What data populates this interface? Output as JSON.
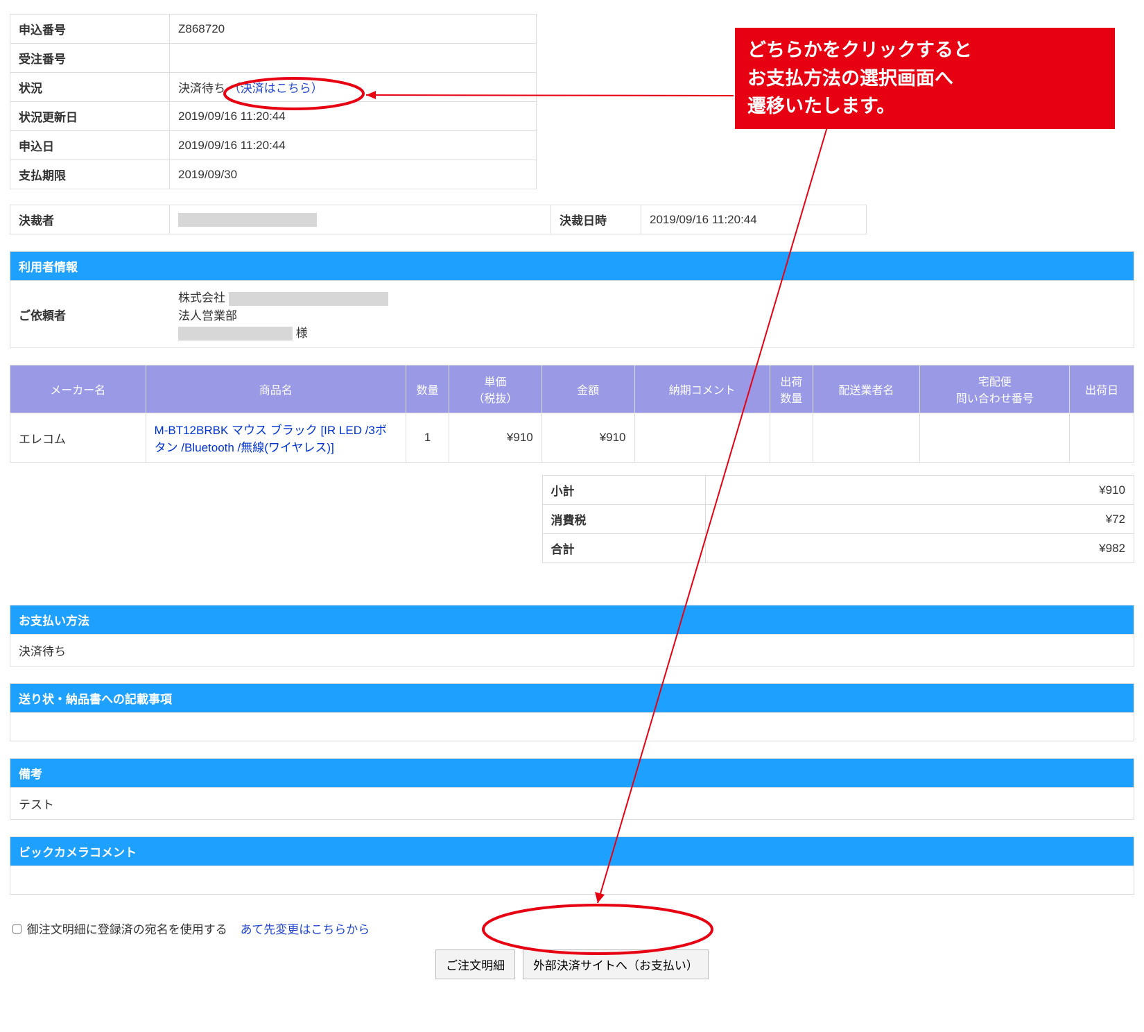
{
  "info": {
    "application_no_label": "申込番号",
    "application_no": "Z868720",
    "order_no_label": "受注番号",
    "order_no": "",
    "status_label": "状況",
    "status_text": "決済待ち",
    "status_link": "（決済はこちら）",
    "status_update_label": "状況更新日",
    "status_update": "2019/09/16 11:20:44",
    "apply_date_label": "申込日",
    "apply_date": "2019/09/16 11:20:44",
    "pay_deadline_label": "支払期限",
    "pay_deadline": "2019/09/30"
  },
  "approver": {
    "person_label": "決裁者",
    "datetime_label": "決裁日時",
    "datetime": "2019/09/16 11:20:44"
  },
  "sections": {
    "user_info": "利用者情報",
    "payment_method": "お支払い方法",
    "delivery_notes": "送り状・納品書への記載事項",
    "remarks": "備考",
    "bic_comment": "ビックカメラコメント"
  },
  "user": {
    "requester_label": "ご依頼者",
    "company_prefix": "株式会社",
    "department": "法人営業部",
    "honorific": "様"
  },
  "products": {
    "headers": {
      "maker": "メーカー名",
      "name": "商品名",
      "qty": "数量",
      "unit_price": "単価\n（税抜）",
      "amount": "金額",
      "delivery_comment": "納期コメント",
      "ship_qty": "出荷\n数量",
      "carrier": "配送業者名",
      "tracking": "宅配便\n問い合わせ番号",
      "ship_date": "出荷日"
    },
    "rows": [
      {
        "maker": "エレコム",
        "name": "M-BT12BRBK マウス ブラック [IR LED /3ボタン /Bluetooth /無線(ワイヤレス)]",
        "qty": "1",
        "unit_price": "¥910",
        "amount": "¥910",
        "delivery_comment": "",
        "ship_qty": "",
        "carrier": "",
        "tracking": "",
        "ship_date": ""
      }
    ]
  },
  "totals": {
    "subtotal_label": "小計",
    "subtotal": "¥910",
    "tax_label": "消費税",
    "tax": "¥72",
    "total_label": "合計",
    "total": "¥982"
  },
  "payment_method_value": "決済待ち",
  "remarks_value": "テスト",
  "footer": {
    "checkbox_label": "御注文明細に登録済の宛名を使用する",
    "change_addr_link": "あて先変更はこちらから",
    "btn_order_detail": "ご注文明細",
    "btn_external_pay": "外部決済サイトへ（お支払い）"
  },
  "callout": {
    "line1": "どちらかをクリックすると",
    "line2": "お支払方法の選択画面へ",
    "line3": "遷移いたします。"
  }
}
